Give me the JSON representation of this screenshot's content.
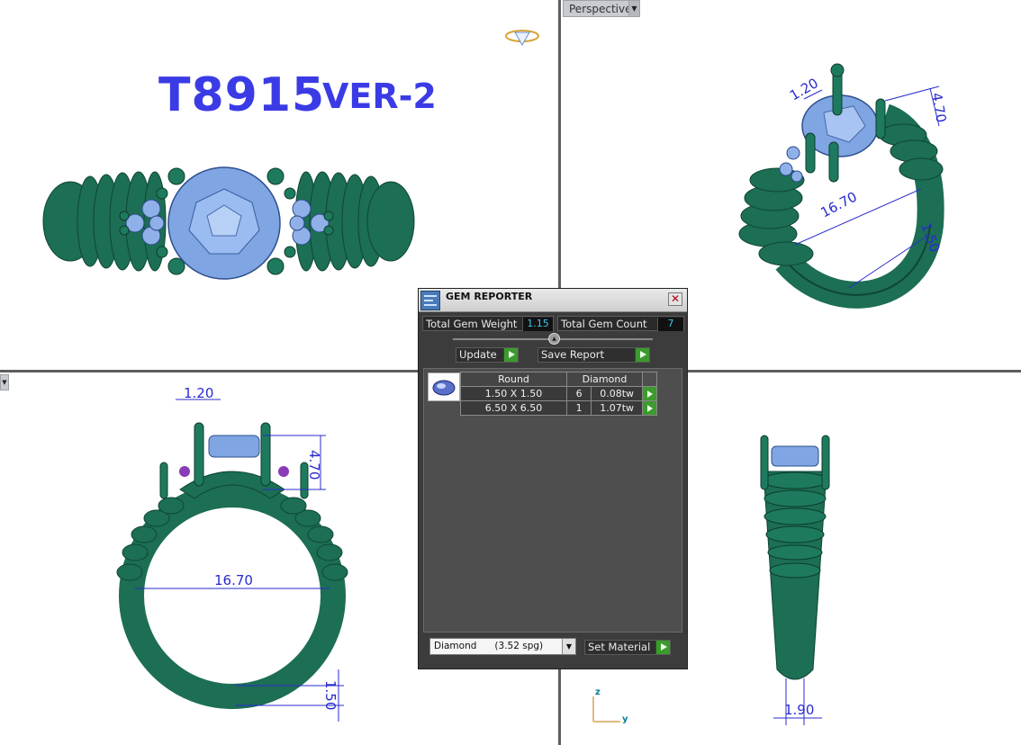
{
  "viewports": {
    "perspective_label": "Perspective",
    "top_left": {
      "title": "T8915",
      "version": "VER-2"
    }
  },
  "dimensions": {
    "perspective": [
      "1.20",
      "4.70",
      "16.70",
      "1.50"
    ],
    "front": {
      "prong": "1.20",
      "height": "4.70",
      "inner": "16.70",
      "band": "1.50"
    },
    "side": {
      "width": "1.90"
    }
  },
  "axis": {
    "z": "z",
    "y": "y"
  },
  "dialog": {
    "title": "GEM REPORTER",
    "total_weight_label": "Total Gem Weight",
    "total_weight_value": "1.15",
    "total_count_label": "Total Gem Count",
    "total_count_value": "7",
    "update_label": "Update",
    "save_label": "Save Report",
    "table": {
      "headers": [
        "Round",
        "Diamond"
      ],
      "rows": [
        {
          "size": "1.50 X 1.50",
          "qty": "6",
          "weight": "0.08tw"
        },
        {
          "size": "6.50 X 6.50",
          "qty": "1",
          "weight": "1.07tw"
        }
      ]
    },
    "material_select": "Diamond      (3.52 spg)",
    "set_material_label": "Set Material"
  },
  "colors": {
    "ring": "#1f7a5c",
    "gem": "#7aa6e6",
    "dimension": "#2a2ad0",
    "title": "#3b3be6"
  }
}
